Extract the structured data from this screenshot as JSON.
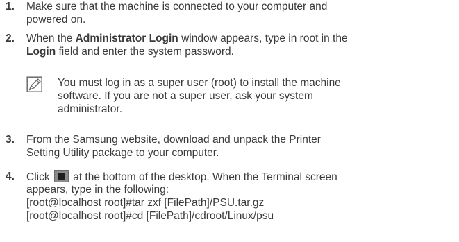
{
  "steps": [
    {
      "number": "1.",
      "lines": [
        "Make sure that the machine is connected to your computer and",
        "powered on."
      ]
    },
    {
      "number": "2.",
      "line1_before": "When the ",
      "line1_bold": "Administrator Login",
      "line1_after": " window appears, type in root in the",
      "line2_bold": "Login",
      "line2_after": " field and enter the system password."
    },
    {
      "number": "3.",
      "lines": [
        "From the Samsung website, download and unpack the Printer",
        "Setting Utility package to your computer."
      ]
    },
    {
      "number": "4.",
      "line1_before": "Click ",
      "line1_after": " at the bottom of the desktop. When the Terminal screen",
      "line2": "appears, type in the following:",
      "commands": [
        "[root@localhost root]#tar zxf [FilePath]/PSU.tar.gz",
        "[root@localhost root]#cd [FilePath]/cdroot/Linux/psu"
      ]
    }
  ],
  "note": {
    "icon": "note-pencil-icon",
    "lines": [
      "You must log in as a super user (root) to install the machine",
      "software. If you are not a super user, ask your system",
      "administrator."
    ]
  }
}
